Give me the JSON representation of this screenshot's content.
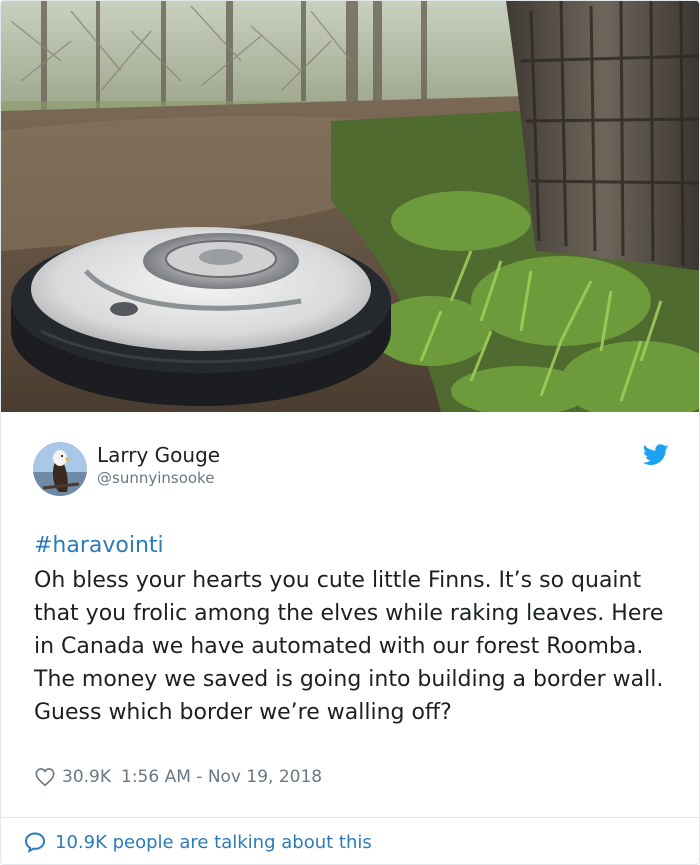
{
  "photo": {
    "subject": "robot-vacuum-on-forest-path"
  },
  "user": {
    "name": "Larry Gouge",
    "handle": "@sunnyinsooke",
    "avatar_icon": "bald-eagle-avatar"
  },
  "tweet": {
    "hashtag": "#haravointi",
    "text": "Oh bless your hearts you cute little Finns. It’s so quaint that you frolic among the elves while raking leaves. Here in Canada we have automated with our forest Roomba. The money we saved is going into building a border wall. Guess which border we’re walling off?",
    "likes": "30.9K",
    "timestamp": "1:56 AM - Nov 19, 2018"
  },
  "footer": {
    "talking": "10.9K people are talking about this"
  },
  "colors": {
    "link": "#2b7bb9",
    "muted": "#697882",
    "text": "#1c2022",
    "twitter_blue": "#1da1f2"
  }
}
